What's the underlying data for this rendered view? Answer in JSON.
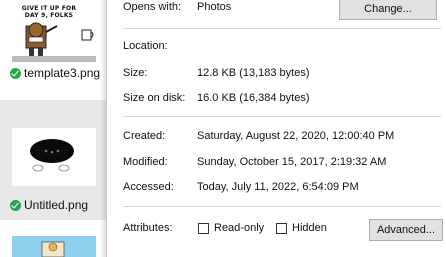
{
  "explorer": {
    "files": [
      {
        "name": "template3.png",
        "meme_text": "GIVE IT UP FOR DAY 9, FOLKS",
        "status_icon": "check-icon"
      },
      {
        "name": "Untitled.png",
        "status_icon": "check-icon"
      }
    ]
  },
  "dialog": {
    "opens_with": {
      "label": "Opens with:",
      "value": "Photos",
      "button": "Change..."
    },
    "location": {
      "label": "Location:",
      "value": ""
    },
    "size": {
      "label": "Size:",
      "value": "12.8 KB (13,183 bytes)"
    },
    "size_on_disk": {
      "label": "Size on disk:",
      "value": "16.0 KB (16,384 bytes)"
    },
    "created": {
      "label": "Created:",
      "value": "Saturday, August 22, 2020, 12:00:40 PM"
    },
    "modified": {
      "label": "Modified:",
      "value": "Sunday, October 15, 2017, 2:19:32 AM"
    },
    "accessed": {
      "label": "Accessed:",
      "value": "Today, July 11, 2022, 6:54:09 PM"
    },
    "attributes": {
      "label": "Attributes:",
      "readonly": "Read-only",
      "hidden": "Hidden",
      "advanced_button": "Advanced..."
    }
  },
  "colors": {
    "status_green": "#26a84a",
    "button_bg": "#e1e1e1",
    "selection_bg": "#e8e8e8"
  }
}
